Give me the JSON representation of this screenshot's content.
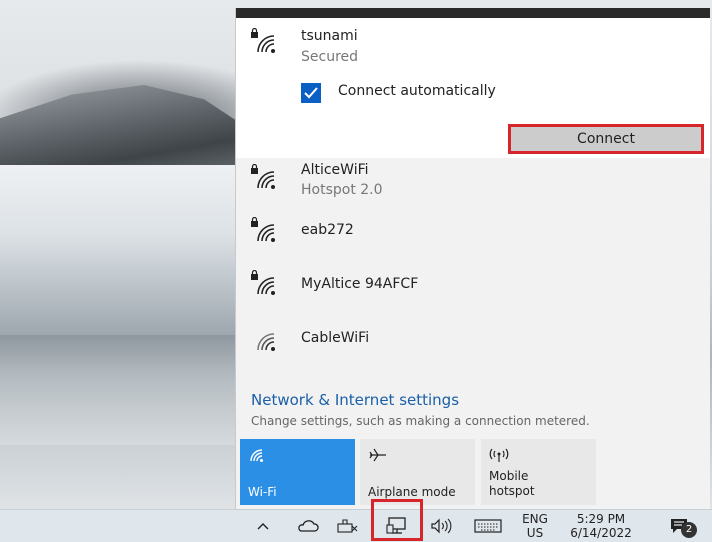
{
  "selected_network": {
    "name": "tsunami",
    "status": "Secured",
    "connect_automatically_label": "Connect automatically",
    "connect_automatically_checked": true,
    "connect_button_label": "Connect"
  },
  "networks": [
    {
      "name": "AlticeWiFi",
      "subtitle": "Hotspot 2.0",
      "secured": true
    },
    {
      "name": "eab272",
      "secured": true
    },
    {
      "name": "MyAltice 94AFCF",
      "secured": true
    },
    {
      "name": "CableWiFi",
      "secured": false
    }
  ],
  "settings": {
    "link": "Network & Internet settings",
    "description": "Change settings, such as making a connection metered."
  },
  "quick_actions": [
    {
      "label": "Wi-Fi",
      "active": true,
      "icon": "wifi-icon"
    },
    {
      "label": "Airplane mode",
      "active": false,
      "icon": "airplane-icon"
    },
    {
      "label": "Mobile hotspot",
      "active": false,
      "icon": "hotspot-icon"
    }
  ],
  "taskbar": {
    "lang_line1": "ENG",
    "lang_line2": "US",
    "time": "5:29 PM",
    "date": "6/14/2022",
    "notification_count": "2"
  },
  "colors": {
    "accent": "#2b8fe6",
    "link": "#1a5fa8",
    "highlight": "#d6262c",
    "checkbox": "#0a5fc4"
  }
}
